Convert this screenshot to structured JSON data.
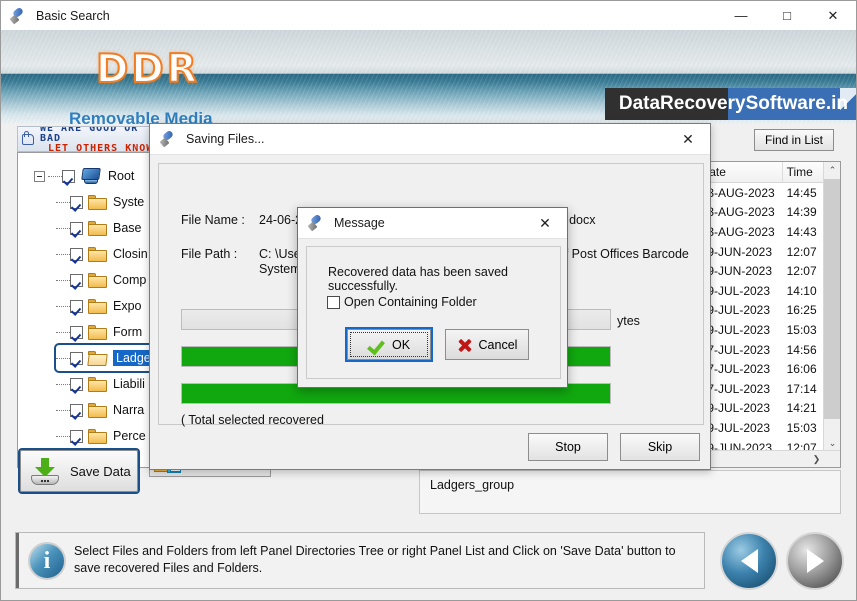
{
  "window": {
    "title": "Basic Search",
    "icon": "pen-icon",
    "minimize": "—",
    "maximize": "□",
    "close": "✕"
  },
  "banner": {
    "logo": "DDR",
    "subtitle": "Removable Media",
    "brand": "DataRecoverySoftware.in"
  },
  "rate_banner": {
    "line1": "WE ARE GOOD OR BAD",
    "line2": "LET OTHERS KNOW",
    "icon": "thumbs-up-icon"
  },
  "tree": {
    "nodes": [
      {
        "label": "Root",
        "checked": true,
        "icon": "computer-icon",
        "level": 0,
        "selected": false
      },
      {
        "label": "Syste",
        "checked": true,
        "icon": "folder-icon",
        "level": 1,
        "selected": false
      },
      {
        "label": "Base",
        "checked": true,
        "icon": "folder-icon",
        "level": 1,
        "selected": false
      },
      {
        "label": "Closin",
        "checked": true,
        "icon": "folder-icon",
        "level": 1,
        "selected": false
      },
      {
        "label": "Comp",
        "checked": true,
        "icon": "folder-icon",
        "level": 1,
        "selected": false
      },
      {
        "label": "Expo",
        "checked": true,
        "icon": "folder-icon",
        "level": 1,
        "selected": false
      },
      {
        "label": "Form",
        "checked": true,
        "icon": "folder-icon",
        "level": 1,
        "selected": false
      },
      {
        "label": "Ladge",
        "checked": true,
        "icon": "folder-open-icon",
        "level": 1,
        "selected": true
      },
      {
        "label": "Liabili",
        "checked": true,
        "icon": "folder-icon",
        "level": 1,
        "selected": false
      },
      {
        "label": "Narra",
        "checked": true,
        "icon": "folder-icon",
        "level": 1,
        "selected": false
      },
      {
        "label": "Perce",
        "checked": true,
        "icon": "folder-icon",
        "level": 1,
        "selected": false
      }
    ]
  },
  "save_data_button": {
    "label": "Save Data",
    "icon": "save-download-icon"
  },
  "find_in_list_button": {
    "label": "Find in List"
  },
  "list": {
    "columns": [
      "Date",
      "Time"
    ],
    "rows": [
      {
        "date": "03-AUG-2023",
        "time": "14:45"
      },
      {
        "date": "03-AUG-2023",
        "time": "14:39"
      },
      {
        "date": "03-AUG-2023",
        "time": "14:43"
      },
      {
        "date": "29-JUN-2023",
        "time": "12:07"
      },
      {
        "date": "29-JUN-2023",
        "time": "12:07"
      },
      {
        "date": "19-JUL-2023",
        "time": "14:10"
      },
      {
        "date": "29-JUL-2023",
        "time": "16:25"
      },
      {
        "date": "29-JUL-2023",
        "time": "15:03"
      },
      {
        "date": "17-JUL-2023",
        "time": "14:56"
      },
      {
        "date": "17-JUL-2023",
        "time": "16:06"
      },
      {
        "date": "17-JUL-2023",
        "time": "17:14"
      },
      {
        "date": "19-JUL-2023",
        "time": "14:21"
      },
      {
        "date": "29-JUL-2023",
        "time": "15:03"
      },
      {
        "date": "29-JUN-2023",
        "time": "12:07"
      }
    ],
    "scroll_up": "⌃",
    "scroll_down": "⌄",
    "scroll_right": "❯"
  },
  "below_list": {
    "text": "Ladgers_group"
  },
  "saving_dialog": {
    "title": "Saving Files...",
    "icon": "pen-icon",
    "close": "✕",
    "file_name_label": "File Name :",
    "file_name_value": "24-06-23Uses Of Post Offices Barcode Systems - Copy.docx",
    "file_path_label": "File Path :",
    "file_path_line1_start": "C: \\Users \\IB",
    "file_path_line1_end": "Of Post Offices Barcode",
    "file_path_line2": "Systems - Co",
    "bytes_label": "ytes",
    "progress1_percent": 0,
    "progress2_percent": 100,
    "progress3_percent": 100,
    "total_text": "( Total selected recovered",
    "stop_label": "Stop",
    "skip_label": "Skip"
  },
  "message_dialog": {
    "title": "Message",
    "icon": "pen-icon",
    "close": "✕",
    "text": "Recovered data has been saved successfully.",
    "checkbox_label": "Open Containing Folder",
    "checkbox_checked": false,
    "ok_label": "OK",
    "cancel_label": "Cancel",
    "ok_icon": "green-check-icon",
    "cancel_icon": "red-x-icon"
  },
  "status": {
    "icon": "info-icon",
    "text": "Select Files and Folders from left Panel Directories Tree or right Panel List and Click on 'Save Data' button to save recovered Files and Folders.",
    "prev_icon": "previous-arrow-icon",
    "next_icon": "next-arrow-icon"
  },
  "colors": {
    "accent_blue": "#1668c8",
    "progress_green": "#11a80f",
    "brand_orange": "#f07d22",
    "brand_blue": "#3b6fb5"
  }
}
